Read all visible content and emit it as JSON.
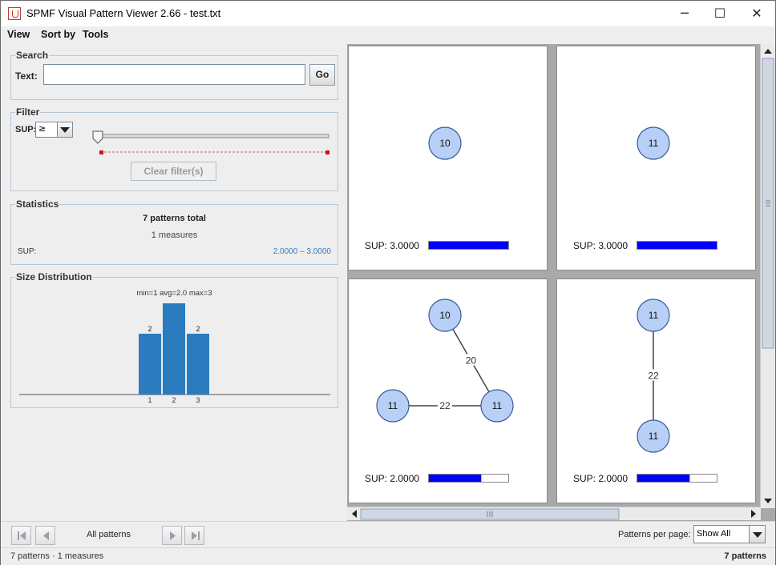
{
  "window": {
    "title": "SPMF Visual Pattern Viewer 2.66 - test.txt",
    "controls": [
      "─",
      "☐",
      "✕"
    ]
  },
  "menu": {
    "items": [
      "View",
      "Sort by",
      "Tools"
    ]
  },
  "search": {
    "title": "Search",
    "text_label": "Text:",
    "value": "",
    "go_label": "Go"
  },
  "filter": {
    "title": "Filter",
    "measure_label": "SUP:",
    "operator": "≥",
    "clear_label": "Clear filter(s)",
    "slider_value": 0
  },
  "statistics": {
    "title": "Statistics",
    "total": "7 patterns total",
    "measures": "1 measures",
    "rows": [
      {
        "name": "SUP:",
        "range": "2.0000 – 3.0000"
      }
    ]
  },
  "size_distribution": {
    "title": "Size Distribution",
    "summary": "min=1  avg=2.0  max=3",
    "chart_data": {
      "type": "bar",
      "categories": [
        "1",
        "2",
        "3"
      ],
      "values": [
        2,
        3,
        2
      ],
      "value_labels": [
        "2",
        "",
        "2"
      ]
    }
  },
  "patterns": [
    {
      "nodes": [
        {
          "label": "10"
        }
      ],
      "edges": [],
      "sup_label": "SUP: 3.0000",
      "sup_fraction": 1.0
    },
    {
      "nodes": [
        {
          "label": "11"
        }
      ],
      "edges": [],
      "sup_label": "SUP: 3.0000",
      "sup_fraction": 1.0
    },
    {
      "nodes": [
        {
          "label": "10"
        },
        {
          "label": "11"
        },
        {
          "label": "11"
        }
      ],
      "edges": [
        {
          "from": 0,
          "to": 2,
          "label": "20"
        },
        {
          "from": 1,
          "to": 2,
          "label": "22"
        }
      ],
      "sup_label": "SUP: 2.0000",
      "sup_fraction": 0.66
    },
    {
      "nodes": [
        {
          "label": "11"
        },
        {
          "label": "11"
        }
      ],
      "edges": [
        {
          "from": 0,
          "to": 1,
          "label": "22"
        }
      ],
      "sup_label": "SUP: 2.0000",
      "sup_fraction": 0.66
    }
  ],
  "colors": {
    "node_fill": "#b8d0f6",
    "node_stroke": "#3a5a99",
    "sup_bar": "#0000ff",
    "size_bar": "#2b7bbf",
    "range_text": "#3a78c0"
  },
  "navigation": {
    "page_label": "All patterns",
    "per_page_label": "Patterns per page:",
    "per_page_value": "Show All"
  },
  "status": {
    "left": "7 patterns · 1 measures",
    "right": "7 patterns"
  }
}
